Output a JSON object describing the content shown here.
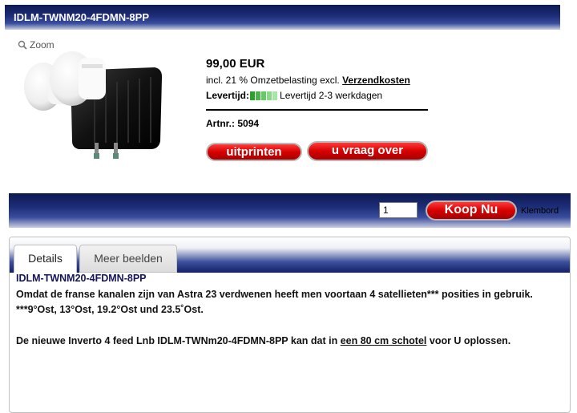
{
  "product": {
    "title": "IDLM-TWNM20-4FDMN-8PP",
    "zoom_label": "Zoom",
    "price": "99,00 EUR",
    "vat_text": "incl. 21 % Omzetbelasting excl.",
    "shipping_link": "Verzendkosten",
    "delivery_label": "Levertijd:",
    "delivery_text": "Levertijd 2-3 werkdagen",
    "delivery_bar_colors": [
      "#2e9e2e",
      "#49b649",
      "#66c966",
      "#88d988",
      "#a8e6a8"
    ],
    "artnr_label": "Artnr.:",
    "artnr_value": "5094",
    "print_button": "uitprinten",
    "ask_button": "u vraag over"
  },
  "cart": {
    "quantity": "1",
    "buy_button": "Koop Nu",
    "clipboard_label": "Klembord"
  },
  "tabs": [
    {
      "label": "Details"
    },
    {
      "label": "Meer beelden"
    }
  ],
  "details": {
    "heading": "IDLM-TWNM20-4FDMN-8PP",
    "line1": "Omdat de franse kanalen zijn van Astra 23 verdwenen heeft men voortaan 4 satellieten*** posities in gebruik.",
    "line2": "***9°Ost, 13°Ost, 19.2°Ost und 23.5˚Ost.",
    "line3_before": "De nieuwe Inverto 4 feed Lnb IDLM-TWNm20-4FDMN-8PP kan dat in ",
    "line3_link": "een 80 cm schotel",
    "line3_after": " voor U oplossen."
  }
}
